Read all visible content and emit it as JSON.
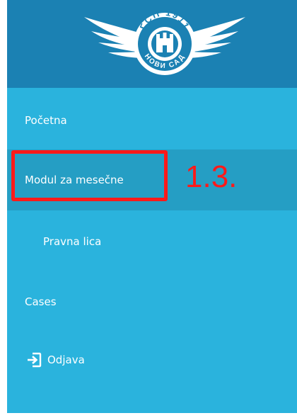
{
  "sidebar": {
    "logo": {
      "name": "club-emblem",
      "text_top": "ГСП 1911",
      "text_bottom": "НОВИ САД"
    },
    "items": [
      {
        "label": "Početna"
      },
      {
        "label": "Modul za mesečne",
        "highlighted": true
      },
      {
        "label": "Pravna lica",
        "indent": true
      },
      {
        "label": "Cases"
      },
      {
        "label": "Odjava",
        "icon": "logout-icon"
      }
    ]
  },
  "annotation": {
    "label": "1.3.",
    "color": "#ff1a1a"
  },
  "colors": {
    "sidebar_bg": "#2ab3dd",
    "logo_band_bg": "#1b81b3",
    "active_item_bg": "#259ec4",
    "text": "#ffffff"
  }
}
